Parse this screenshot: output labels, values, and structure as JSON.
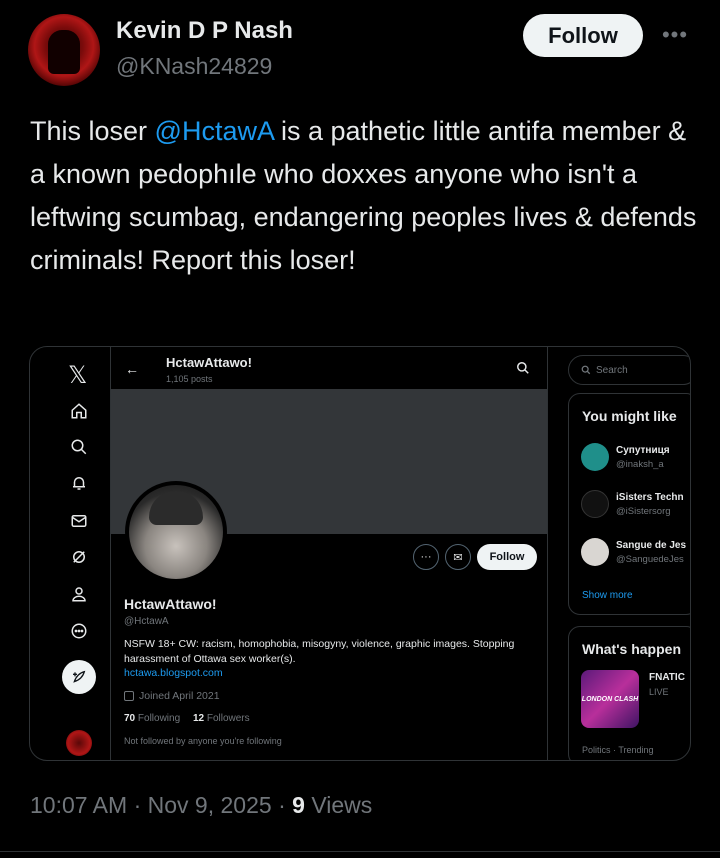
{
  "tweet": {
    "author_name": "Kevin D P Nash",
    "author_handle": "@KNash24829",
    "follow_label": "Follow",
    "more_label": "•••",
    "text_before": "This loser ",
    "mention": "@HctawA",
    "text_after": " is a pathetic little antifa member & a known pedophıle who doxxes anyone who isn't a leftwing scumbag, endangering peoples lives & defends criminals! Report this loser!",
    "time": "10:07 AM",
    "sep": "·",
    "date": "Nov 9, 2025",
    "views_count": "9",
    "views_label": "Views"
  },
  "screenshot": {
    "nav_icons": [
      "x-logo",
      "home-icon",
      "search-icon",
      "notifications-icon",
      "messages-icon",
      "grok-icon",
      "profile-icon",
      "more-icon",
      "post-icon"
    ],
    "profile": {
      "back_glyph": "←",
      "title": "HctawAttawo!",
      "post_count": "1,105 posts",
      "name": "HctawAttawo!",
      "handle": "@HctawA",
      "bio": "NSFW 18+ CW: racism, homophobia, misogyny, violence, graphic images. Stopping harassment of Ottawa sex worker(s).",
      "link": "hctawa.blogspot.com",
      "joined": "Joined April 2021",
      "following_count": "70",
      "following_label": "Following",
      "followers_count": "12",
      "followers_label": "Followers",
      "note": "Not followed by anyone you're following",
      "follow_label": "Follow",
      "more_glyph": "···",
      "message_glyph": "✉"
    },
    "sidebar": {
      "search_placeholder": "Search",
      "wtf_title": "You might like",
      "suggestions": [
        {
          "name": "Супутниця",
          "handle": "@inaksh_a",
          "color": "#1f8f8a"
        },
        {
          "name": "iSisters Techn",
          "handle": "@iSistersorg",
          "color": "#111"
        },
        {
          "name": "Sangue de Jes",
          "handle": "@SanguedeJes",
          "color": "#d9d6d2"
        }
      ],
      "show_more": "Show more",
      "happening_title": "What's happen",
      "trend_name": "FNATIC",
      "trend_status": "LIVE",
      "trend_image_text": "LONDON CLASH",
      "trend_category": "Politics · Trending"
    }
  }
}
